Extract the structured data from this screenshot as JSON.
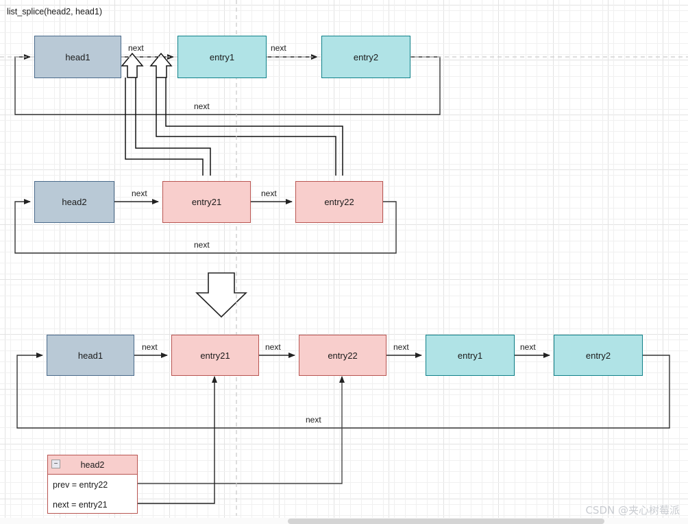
{
  "diagram": {
    "title": "list_splice(head2, head1)",
    "watermark": "CSDN @夹心树莓派",
    "colors": {
      "head_fill": "#b9c9d6",
      "head_stroke": "#49698a",
      "cyan_fill": "#b0e3e6",
      "cyan_stroke": "#0e8088",
      "pink_fill": "#f8cecc",
      "pink_stroke": "#b85450",
      "wire": "#333333",
      "wire_gray": "#555555",
      "grid_minor": "#f0f0f0",
      "grid_major": "#e2e2e2"
    }
  },
  "before": {
    "list1": {
      "nodes": [
        {
          "id": "head1",
          "label": "head1",
          "kind": "head"
        },
        {
          "id": "entry1",
          "label": "entry1",
          "kind": "cyan"
        },
        {
          "id": "entry2",
          "label": "entry2",
          "kind": "cyan"
        }
      ],
      "edge_labels": {
        "head1_to_entry1": "next",
        "entry1_to_entry2": "next",
        "entry2_to_head1": "next"
      }
    },
    "list2": {
      "nodes": [
        {
          "id": "head2",
          "label": "head2",
          "kind": "head"
        },
        {
          "id": "entry21",
          "label": "entry21",
          "kind": "pink"
        },
        {
          "id": "entry22",
          "label": "entry22",
          "kind": "pink"
        }
      ],
      "edge_labels": {
        "head2_to_entry21": "next",
        "entry21_to_entry22": "next",
        "entry22_to_head2": "next"
      }
    }
  },
  "transition": {
    "arrow": "down-arrow"
  },
  "after": {
    "nodes": [
      {
        "id": "head1",
        "label": "head1",
        "kind": "head"
      },
      {
        "id": "entry21",
        "label": "entry21",
        "kind": "pink"
      },
      {
        "id": "entry22",
        "label": "entry22",
        "kind": "pink"
      },
      {
        "id": "entry1",
        "label": "entry1",
        "kind": "cyan"
      },
      {
        "id": "entry2",
        "label": "entry2",
        "kind": "cyan"
      }
    ],
    "edge_labels": {
      "head1_to_entry21": "next",
      "entry21_to_entry22": "next",
      "entry22_to_entry1": "next",
      "entry1_to_entry2": "next",
      "entry2_to_head1": "next"
    }
  },
  "head2_detail": {
    "title": "head2",
    "collapse_glyph": "−",
    "fields": [
      "prev = entry22",
      "next = entry21"
    ]
  }
}
